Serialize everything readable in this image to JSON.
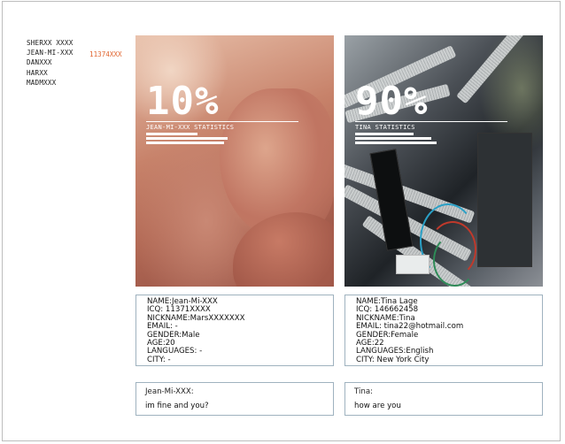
{
  "contacts": [
    {
      "name": "SHERXX XXXX"
    },
    {
      "name": "JEAN-MI-XXX"
    },
    {
      "name": "DANXXX"
    },
    {
      "name": "HARXX"
    },
    {
      "name": "MADMXXX"
    }
  ],
  "contact_highlight_id": "11374XXX",
  "panels": {
    "left": {
      "percent_label": "10%",
      "stats_title": "JEAN-MI-XXX STATISTICS",
      "info": {
        "name": "NAME:Jean-Mi-XXX",
        "icq": "ICQ: 11371XXXX",
        "nickname": "NICKNAME:MarsXXXXXXX",
        "email": "EMAIL: -",
        "gender": "GENDER:Male",
        "age": "AGE:20",
        "languages": "LANGUAGES: -",
        "city": "CITY: -"
      },
      "chat": {
        "who": "Jean-Mi-XXX:",
        "message": "im fine and you?"
      }
    },
    "right": {
      "percent_label": "90%",
      "stats_title": "TINA STATISTICS",
      "info": {
        "name": "NAME:Tina Lage",
        "icq": "ICQ: 146662458",
        "nickname": "NICKNAME:Tina",
        "email": "EMAIL: tina22@hotmail.com",
        "gender": "GENDER:Female",
        "age": "AGE:22",
        "languages": "LANGUAGES:English",
        "city": "CITY: New York City"
      },
      "chat": {
        "who": "Tina:",
        "message": "how are you"
      }
    }
  },
  "colors": {
    "accent_id": "#e0642e",
    "box_border": "#9fb2bf"
  }
}
